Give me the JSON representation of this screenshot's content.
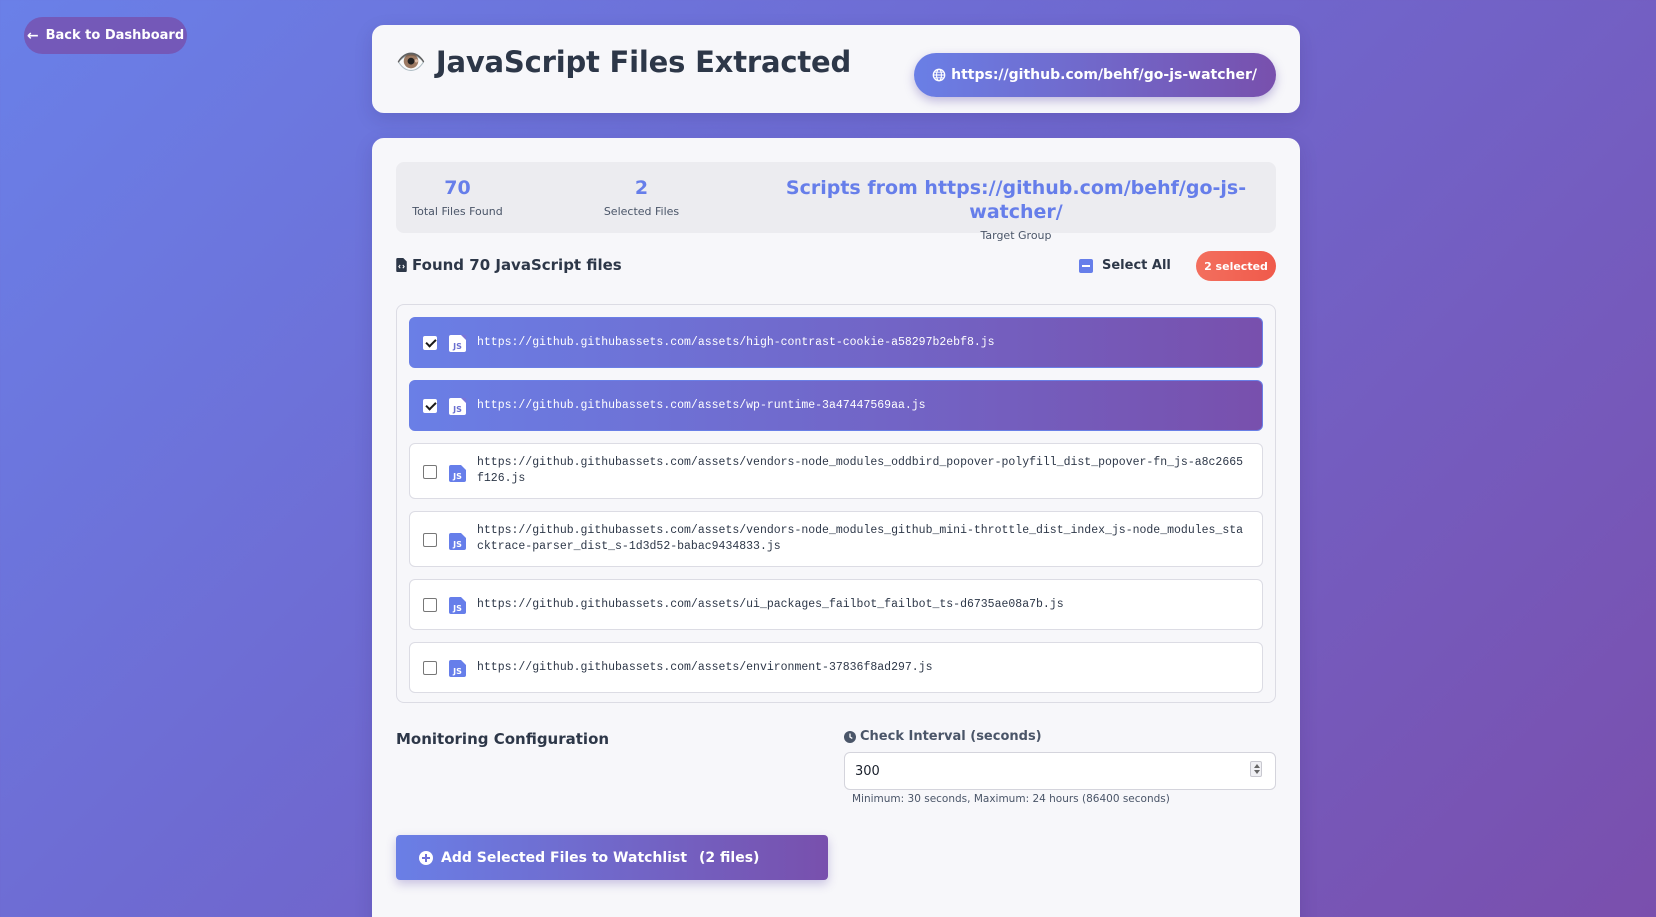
{
  "nav": {
    "back_label": "Back to Dashboard"
  },
  "header": {
    "title": "JavaScript Files Extracted",
    "eye_icon": "eye-icon",
    "target_url": "https://github.com/behf/go-js-watcher/"
  },
  "stats": {
    "total_files": "70",
    "total_files_label": "Total Files Found",
    "selected_files": "2",
    "selected_files_label": "Selected Files",
    "target_group": "Scripts from https://github.com/behf/go-js-watcher/",
    "target_group_label": "Target Group"
  },
  "files_header": {
    "title": "Found 70 JavaScript files",
    "select_all_label": "Select All",
    "selected_badge": "2 selected"
  },
  "files": [
    {
      "url": "https://github.githubassets.com/assets/high-contrast-cookie-a58297b2ebf8.js",
      "selected": true
    },
    {
      "url": "https://github.githubassets.com/assets/wp-runtime-3a47447569aa.js",
      "selected": true
    },
    {
      "url": "https://github.githubassets.com/assets/vendors-node_modules_oddbird_popover-polyfill_dist_popover-fn_js-a8c2665f126.js",
      "selected": false
    },
    {
      "url": "https://github.githubassets.com/assets/vendors-node_modules_github_mini-throttle_dist_index_js-node_modules_stacktrace-parser_dist_s-1d3d52-babac9434833.js",
      "selected": false
    },
    {
      "url": "https://github.githubassets.com/assets/ui_packages_failbot_failbot_ts-d6735ae08a7b.js",
      "selected": false
    },
    {
      "url": "https://github.githubassets.com/assets/environment-37836f8ad297.js",
      "selected": false
    }
  ],
  "monitoring": {
    "title": "Monitoring Configuration",
    "interval_label": "Check Interval (seconds)",
    "interval_value": "300",
    "interval_help": "Minimum: 30 seconds, Maximum: 24 hours (86400 seconds)"
  },
  "actions": {
    "add_label": "Add Selected Files to Watchlist",
    "add_count": "(2 files)"
  },
  "colors": {
    "accent": "#667eea",
    "accent_end": "#764ba2",
    "badge": "#f05a4b"
  }
}
